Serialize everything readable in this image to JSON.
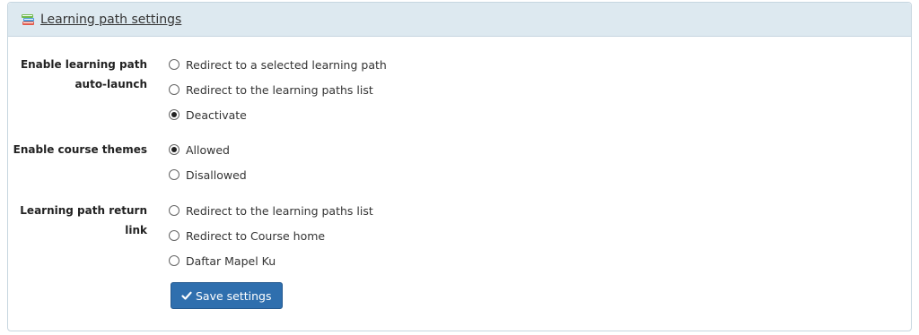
{
  "panel": {
    "title": "Learning path settings",
    "icon": "books-icon"
  },
  "settings": [
    {
      "label": "Enable learning path auto-launch",
      "options": [
        {
          "label": "Redirect to a selected learning path",
          "checked": false
        },
        {
          "label": "Redirect to the learning paths list",
          "checked": false
        },
        {
          "label": "Deactivate",
          "checked": true
        }
      ]
    },
    {
      "label": "Enable course themes",
      "options": [
        {
          "label": "Allowed",
          "checked": true
        },
        {
          "label": "Disallowed",
          "checked": false
        }
      ]
    },
    {
      "label": "Learning path return link",
      "options": [
        {
          "label": "Redirect to the learning paths list",
          "checked": false
        },
        {
          "label": "Redirect to Course home",
          "checked": false
        },
        {
          "label": "Daftar Mapel Ku",
          "checked": false
        }
      ]
    }
  ],
  "save_button": {
    "label": "Save settings",
    "icon": "check-icon"
  },
  "colors": {
    "heading_bg": "#dde9f0",
    "button_bg": "#2f6fae"
  }
}
